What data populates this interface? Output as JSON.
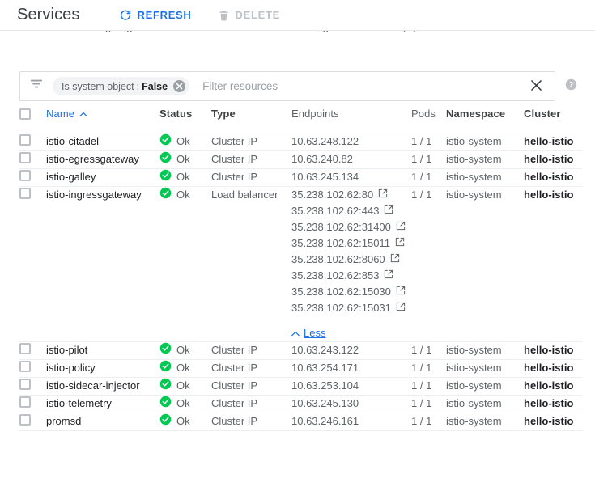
{
  "header": {
    "title": "Services",
    "refresh_label": "REFRESH",
    "delete_label": "DELETE"
  },
  "description": "and load balancing. Ingresses are collections of rules for routing external HTTP(S) traffic to Services.",
  "filter": {
    "chip_key": "Is system object",
    "chip_separator": ":",
    "chip_value": "False",
    "placeholder": "Filter resources",
    "value": ""
  },
  "table": {
    "columns": {
      "name": "Name",
      "status": "Status",
      "type": "Type",
      "endpoints": "Endpoints",
      "pods": "Pods",
      "namespace": "Namespace",
      "cluster": "Cluster"
    },
    "sort_column": "Name",
    "sort_direction": "ascending",
    "less_label": "Less",
    "rows": [
      {
        "name": "istio-citadel",
        "status": "Ok",
        "type": "Cluster IP",
        "endpoints": [
          "10.63.248.122"
        ],
        "endpoint_links": false,
        "pods": "1 / 1",
        "namespace": "istio-system",
        "cluster": "hello-istio"
      },
      {
        "name": "istio-egressgateway",
        "status": "Ok",
        "type": "Cluster IP",
        "endpoints": [
          "10.63.240.82"
        ],
        "endpoint_links": false,
        "pods": "1 / 1",
        "namespace": "istio-system",
        "cluster": "hello-istio"
      },
      {
        "name": "istio-galley",
        "status": "Ok",
        "type": "Cluster IP",
        "endpoints": [
          "10.63.245.134"
        ],
        "endpoint_links": false,
        "pods": "1 / 1",
        "namespace": "istio-system",
        "cluster": "hello-istio"
      },
      {
        "name": "istio-ingressgateway",
        "status": "Ok",
        "type": "Load balancer",
        "endpoints": [
          "35.238.102.62:80",
          "35.238.102.62:443",
          "35.238.102.62:31400",
          "35.238.102.62:15011",
          "35.238.102.62:8060",
          "35.238.102.62:853",
          "35.238.102.62:15030",
          "35.238.102.62:15031"
        ],
        "endpoint_links": true,
        "expanded": true,
        "pods": "1 / 1",
        "namespace": "istio-system",
        "cluster": "hello-istio"
      },
      {
        "name": "istio-pilot",
        "status": "Ok",
        "type": "Cluster IP",
        "endpoints": [
          "10.63.243.122"
        ],
        "endpoint_links": false,
        "pods": "1 / 1",
        "namespace": "istio-system",
        "cluster": "hello-istio"
      },
      {
        "name": "istio-policy",
        "status": "Ok",
        "type": "Cluster IP",
        "endpoints": [
          "10.63.254.171"
        ],
        "endpoint_links": false,
        "pods": "1 / 1",
        "namespace": "istio-system",
        "cluster": "hello-istio"
      },
      {
        "name": "istio-sidecar-injector",
        "status": "Ok",
        "type": "Cluster IP",
        "endpoints": [
          "10.63.253.104"
        ],
        "endpoint_links": false,
        "pods": "1 / 1",
        "namespace": "istio-system",
        "cluster": "hello-istio"
      },
      {
        "name": "istio-telemetry",
        "status": "Ok",
        "type": "Cluster IP",
        "endpoints": [
          "10.63.245.130"
        ],
        "endpoint_links": false,
        "pods": "1 / 1",
        "namespace": "istio-system",
        "cluster": "hello-istio"
      },
      {
        "name": "promsd",
        "status": "Ok",
        "type": "Cluster IP",
        "endpoints": [
          "10.63.246.161"
        ],
        "endpoint_links": false,
        "pods": "1 / 1",
        "namespace": "istio-system",
        "cluster": "hello-istio"
      }
    ]
  },
  "colors": {
    "accent": "#1a73e8",
    "status_ok": "#00c853",
    "text_primary": "#202124",
    "text_secondary": "#5f6368",
    "disabled": "#bdc1c6",
    "border": "#dadce0"
  }
}
